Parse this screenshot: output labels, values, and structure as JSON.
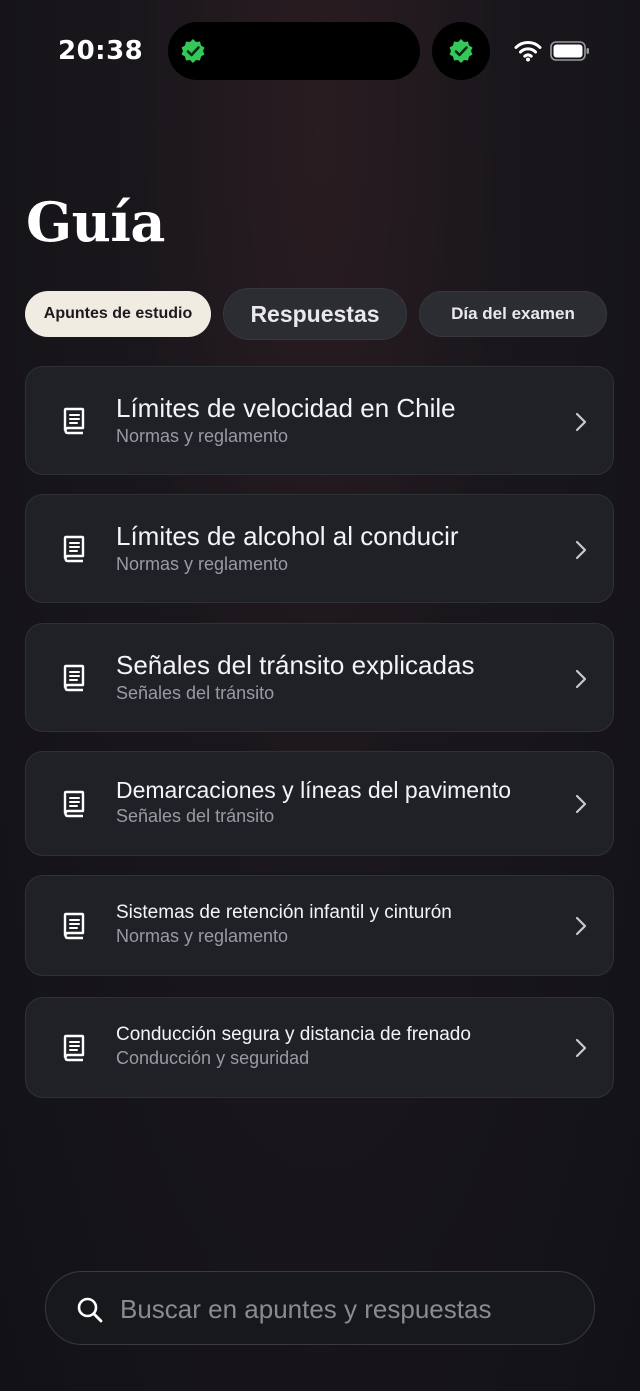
{
  "status_bar": {
    "time": "20:38"
  },
  "page": {
    "title": "Guía"
  },
  "tabs": [
    {
      "label": "Apuntes de estudio",
      "selected": true
    },
    {
      "label": "Respuestas",
      "selected": false
    },
    {
      "label": "Día del examen",
      "selected": false
    }
  ],
  "cards": [
    {
      "title": "Límites de velocidad en Chile",
      "subtitle": "Normas y reglamento",
      "icon": "book-icon"
    },
    {
      "title": "Límites de alcohol al conducir",
      "subtitle": "Normas y reglamento",
      "icon": "book-icon"
    },
    {
      "title": "Señales del tránsito explicadas",
      "subtitle": "Señales del tránsito",
      "icon": "book-icon"
    },
    {
      "title": "Demarcaciones y líneas del pavimento",
      "subtitle": "Señales del tránsito",
      "icon": "book-icon"
    },
    {
      "title": "Sistemas de retención infantil y cinturón",
      "subtitle": "Normas y reglamento",
      "icon": "book-icon"
    },
    {
      "title": "Conducción segura y distancia de frenado",
      "subtitle": "Conducción y seguridad",
      "icon": "book-icon"
    }
  ],
  "search": {
    "placeholder": "Buscar en apuntes y respuestas",
    "value": ""
  },
  "colors": {
    "verified_badge": "#34c759",
    "selected_tab_bg": "#f1ece1",
    "card_bg": "#1f2127"
  }
}
